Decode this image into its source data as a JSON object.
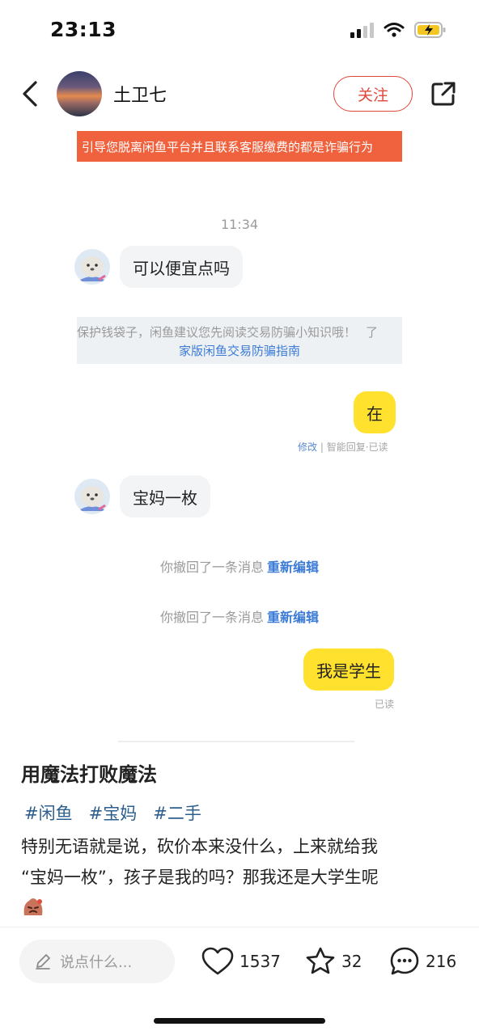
{
  "status_bar": {
    "time": "23:13"
  },
  "header": {
    "user_name": "土卫七",
    "follow_label": "关注"
  },
  "warning_banner": "引导您脱离闲鱼平台并且联系客服缴费的都是诈骗行为",
  "chat": {
    "time_label": "11:34",
    "messages": [
      {
        "side": "left",
        "text": "可以便宜点吗"
      },
      {
        "side": "right",
        "text": "在"
      },
      {
        "side": "left",
        "text": "宝妈一枚"
      },
      {
        "side": "right",
        "text": "我是学生"
      }
    ],
    "tip": {
      "line1": "保护钱袋子，闲鱼建议您先阅读交易防骗小知识哦！",
      "line1_tail": "了",
      "line2": "家版闲鱼交易防骗指南"
    },
    "meta_after_zai": {
      "edit": "修改",
      "rest": "| 智能回复·已读"
    },
    "recalls": [
      {
        "text": "你撤回了一条消息",
        "action": "重新编辑"
      },
      {
        "text": "你撤回了一条消息",
        "action": "重新编辑"
      }
    ],
    "read_label": "已读"
  },
  "post": {
    "title": "用魔法打败魔法",
    "tags": [
      "#闲鱼",
      "#宝妈",
      "#二手"
    ],
    "body_line1": "特别无语就是说，砍价本来没什么，上来就给我",
    "body_line2": "“宝妈一枚”，孩子是我的吗？那我还是大学生呢"
  },
  "bottom_bar": {
    "comment_placeholder": "说点什么...",
    "likes": "1537",
    "stars": "32",
    "comments": "216"
  },
  "colors": {
    "accent_red": "#e0473a",
    "banner_bg": "#f0623e",
    "my_bubble": "#ffe12e",
    "link_blue": "#3b7bd6",
    "tag_blue": "#2c5e8e"
  },
  "icons": [
    "back-arrow-icon",
    "share-icon",
    "pencil-icon",
    "heart-icon",
    "star-icon",
    "comment-icon",
    "wifi-icon",
    "battery-icon"
  ]
}
